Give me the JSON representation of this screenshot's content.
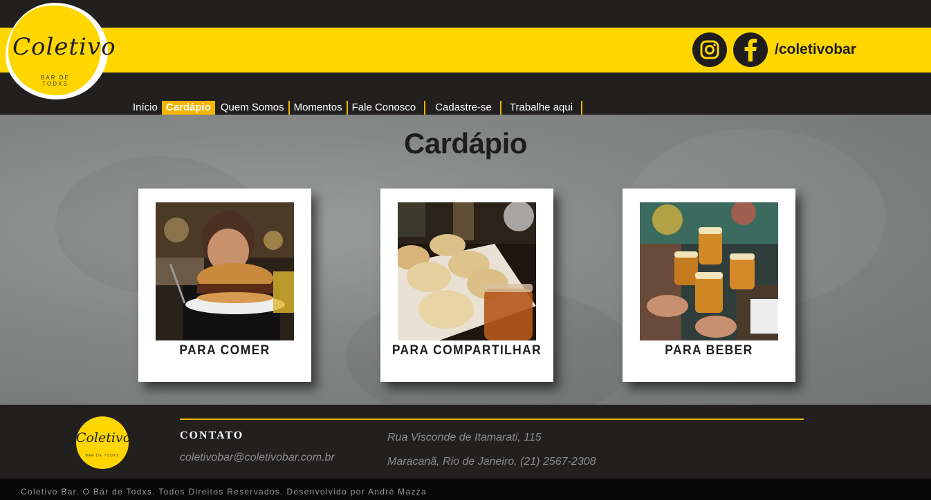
{
  "header": {
    "logo_text": "Coletivo",
    "logo_sub": "BAR DE TODXS",
    "social_handle": "/coletivobar",
    "instagram_icon": "instagram-icon",
    "facebook_icon": "facebook-icon"
  },
  "nav": {
    "items": [
      {
        "label": "Início",
        "active": false
      },
      {
        "label": "Cardápio",
        "active": true
      },
      {
        "label": "Quem Somos",
        "active": false
      },
      {
        "label": "Momentos",
        "active": false
      },
      {
        "label": "Fale Conosco",
        "active": false
      },
      {
        "label": "Cadastre-se",
        "active": false
      },
      {
        "label": "Trabalhe aqui",
        "active": false
      }
    ]
  },
  "main": {
    "title": "Cardápio",
    "cards": [
      {
        "label": "PARA COMER"
      },
      {
        "label": "PARA COMPARTILHAR"
      },
      {
        "label": "PARA BEBER"
      }
    ]
  },
  "footer": {
    "logo_text": "Coletivo",
    "logo_sub": "BAR DE TODXS",
    "contact_heading": "CONTATO",
    "email": "coletivobar@coletivobar.com.br",
    "address_line1": "Rua Visconde de Itamarati, 115",
    "address_line2": "Maracanã, Rio de Janeiro, (21) 2567-2308",
    "copyright": "Coletivo Bar. O Bar de Todxs. Todos Direitos Reservados. Desenvolvido por André Mazza"
  },
  "colors": {
    "brand_yellow": "#ffd600",
    "accent_orange": "#f4b400",
    "dark": "#221f1f"
  }
}
